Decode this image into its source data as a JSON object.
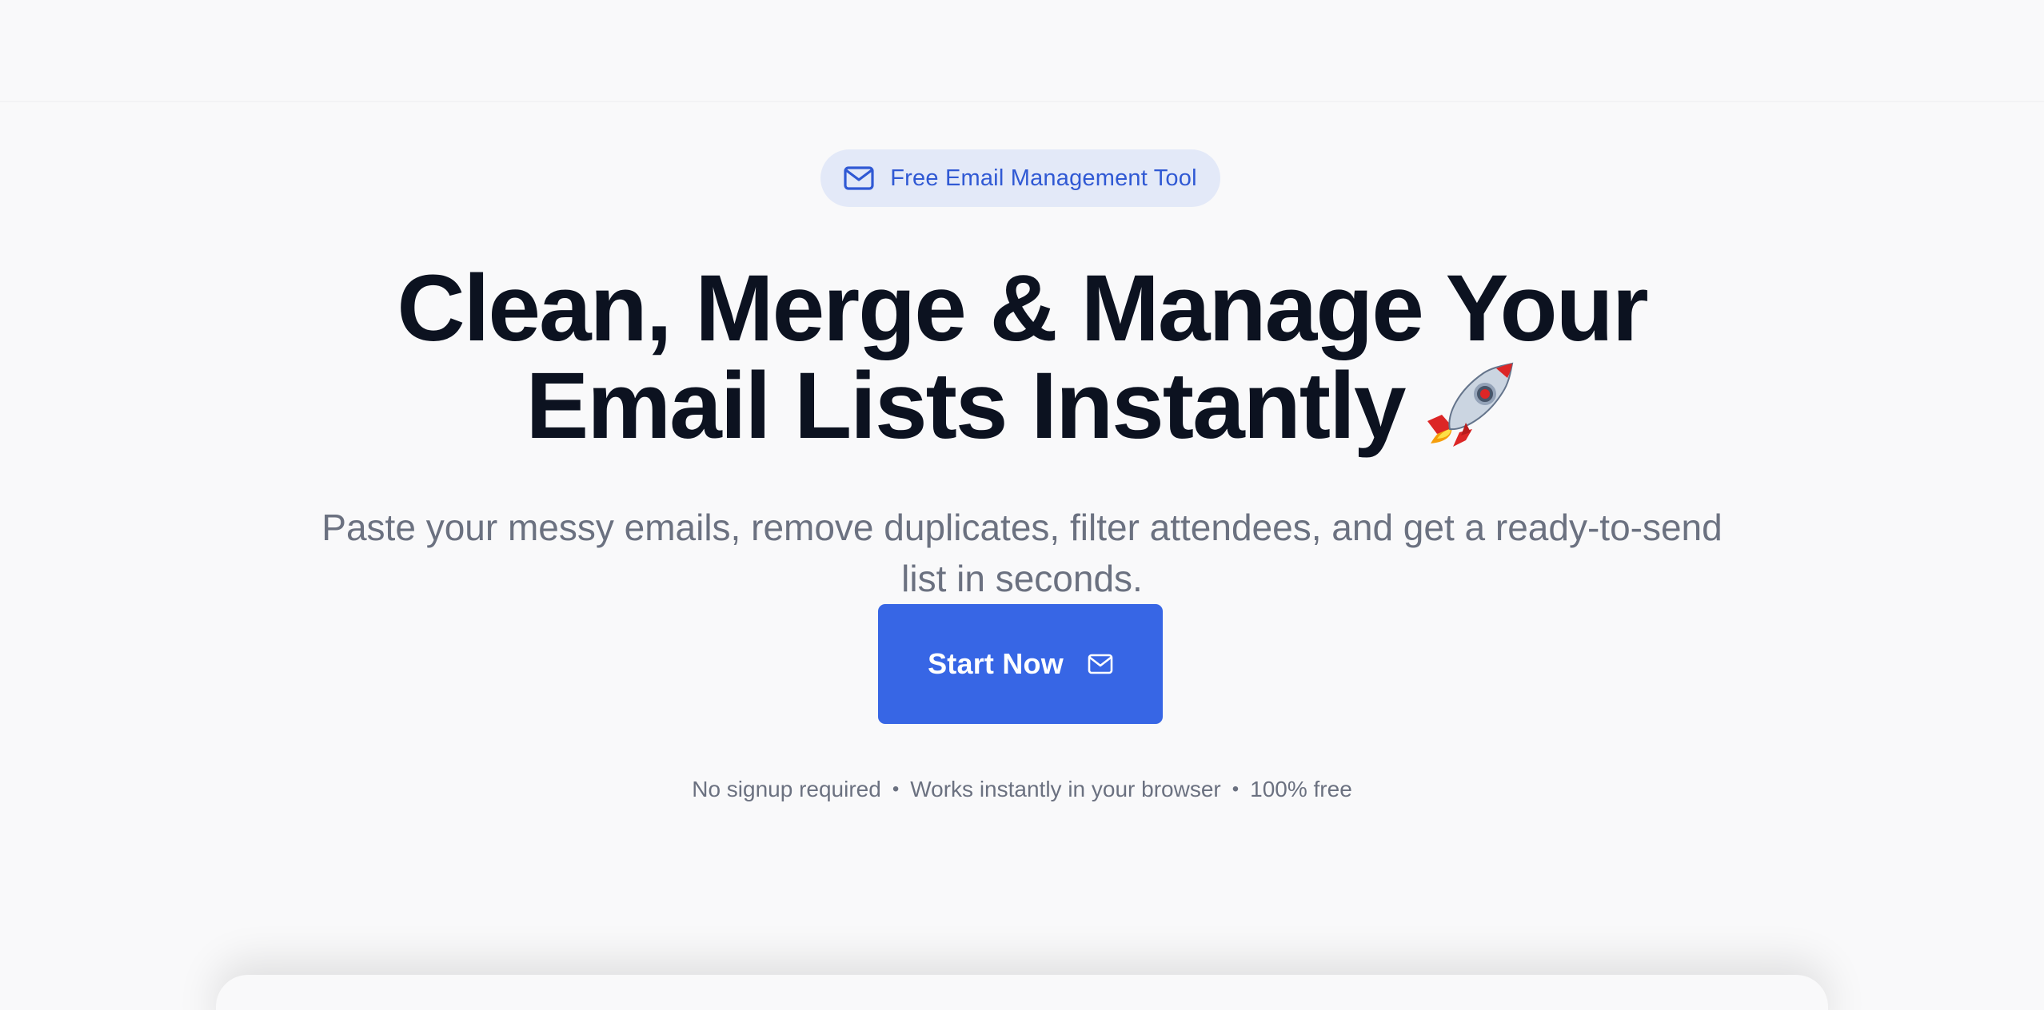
{
  "badge": {
    "icon": "mail-icon",
    "label": "Free Email Management Tool",
    "color": "#3059d4",
    "background": "#e3e9f8"
  },
  "hero": {
    "headline_line1": "Clean, Merge & Manage Your",
    "headline_line2": "Email Lists Instantly",
    "headline_emoji": "rocket-icon",
    "subtitle": "Paste your messy emails, remove duplicates, filter attendees, and get a ready-to-send list in seconds."
  },
  "cta": {
    "label": "Start Now",
    "icon": "mail-icon",
    "color": "#3766e5"
  },
  "footnote": {
    "items": [
      "No signup required",
      "Works instantly in your browser",
      "100% free"
    ],
    "separator": "•"
  }
}
